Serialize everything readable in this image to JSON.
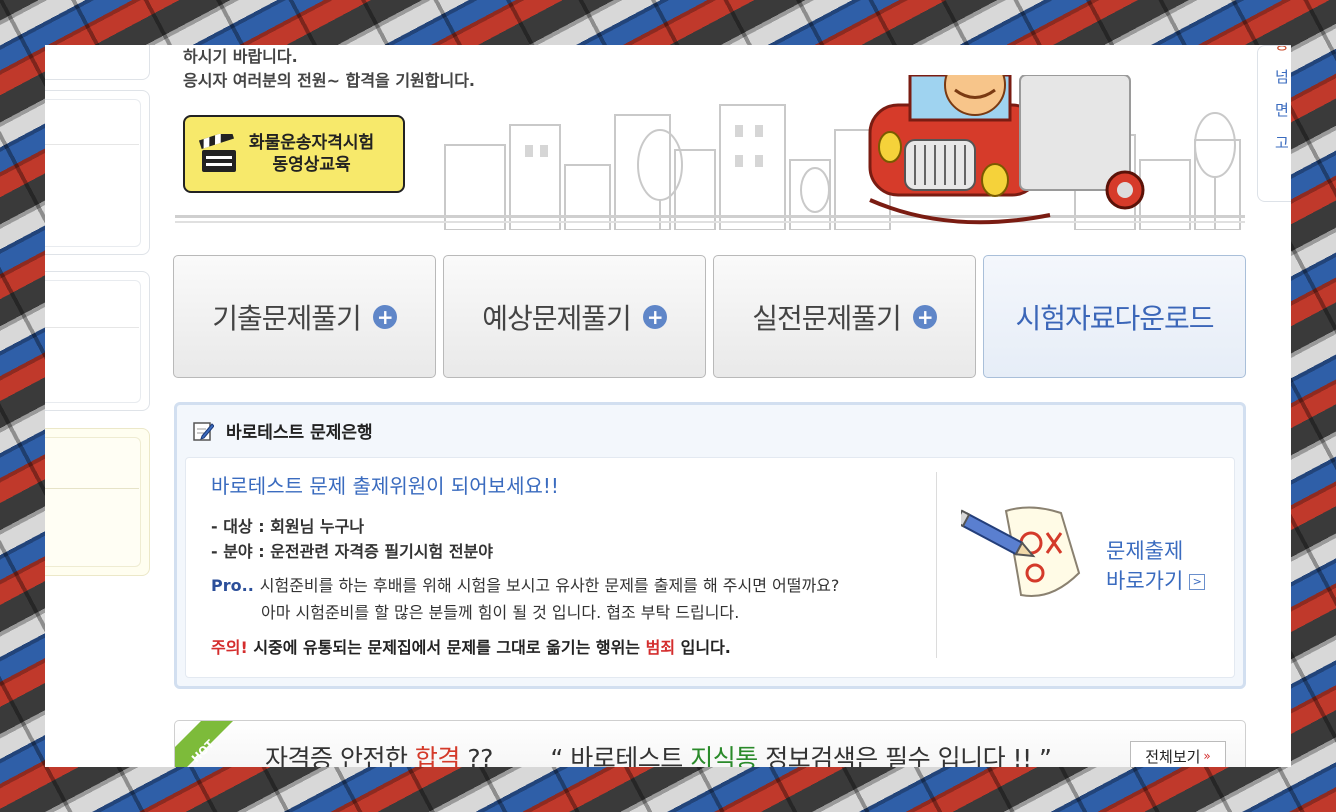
{
  "banner": {
    "line1": "하시기 바랍니다.",
    "line2": "응시자 여러분의 전원~ 합격을 기원합니다.",
    "video_button": {
      "line1": "화물운송자격시험",
      "line2": "동영상교육"
    }
  },
  "right_sidebar": {
    "chars": [
      "중",
      "넘",
      "면",
      "고"
    ]
  },
  "menu": [
    {
      "label": "기출문제풀기",
      "plus": "+"
    },
    {
      "label": "예상문제풀기",
      "plus": "+"
    },
    {
      "label": "실전문제풀기",
      "plus": "+"
    },
    {
      "label": "시험자료다운로드"
    }
  ],
  "bank": {
    "title": "바로테스트 문제은행",
    "headline": "바로테스트 문제 출제위원이 되어보세요!!",
    "target": "- 대상 : 회원님 누구나",
    "field": "- 분야 : 운전관련 자격증 필기시험 전분야",
    "pro_label": "Pro..",
    "pro_line1": "시험준비를 하는 후배를 위해 시험을 보시고 유사한 문제를 출제를 해 주시면 어떨까요?",
    "pro_line2": "아마 시험준비를 할 많은 분들께 힘이 될 것 입니다. 협조 부탁 드립니다.",
    "warn_label": "주의!",
    "warn_text_a": "시중에 유통되는 문제집에서 문제를 그대로 옮기는 행위는",
    "warn_crime": "범죄",
    "warn_text_b": "입니다.",
    "make_line1": "문제출제",
    "make_line2": "바로가기",
    "make_arrow": ">"
  },
  "hot": {
    "ribbon": "HOT",
    "a": "자격증 안전한",
    "b": "합격",
    "c": "??",
    "d": "“ 바로테스트",
    "e": "지식통",
    "f": "정보검색은 필수 입니다 !! ”",
    "view_all": "전체보기",
    "view_all_chevron": "»"
  },
  "colors": {
    "accent": "#3a6bbf",
    "warning": "#d42d2d",
    "button_yellow": "#f7e96b"
  }
}
